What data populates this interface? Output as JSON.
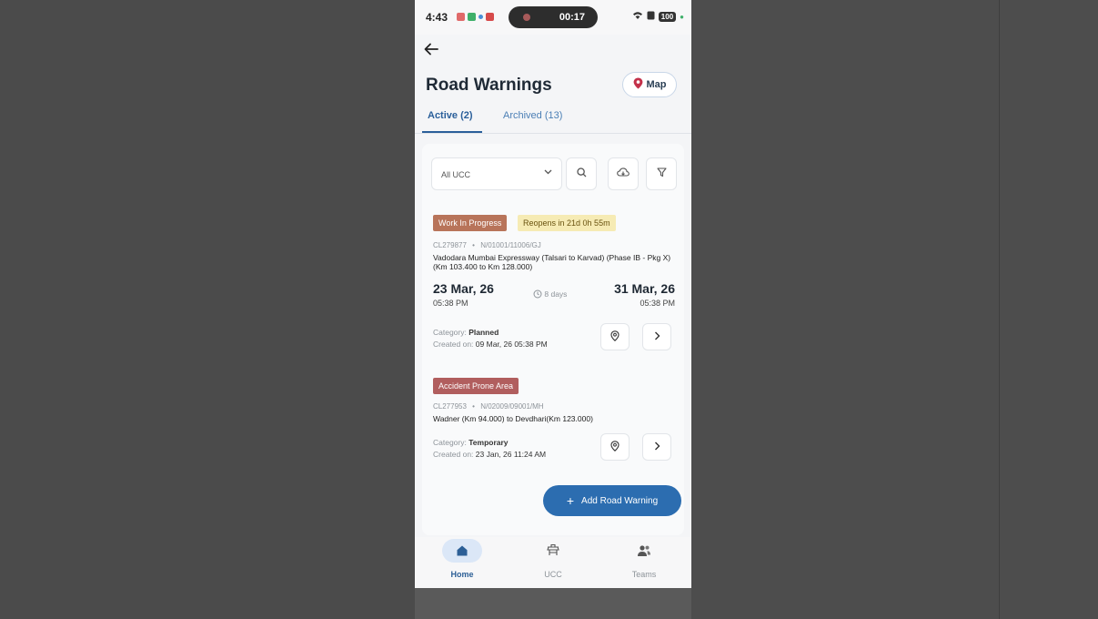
{
  "status_bar": {
    "time": "4:43",
    "timer": "00:17",
    "battery": "100"
  },
  "header": {
    "title": "Road Warnings",
    "map_label": "Map"
  },
  "tabs": [
    {
      "label": "Active (2)",
      "active": true
    },
    {
      "label": "Archived (13)",
      "active": false
    }
  ],
  "filters": {
    "ucc_select": "All UCC"
  },
  "warnings": [
    {
      "status": "Work In Progress",
      "reopen": "Reopens in 21d 0h 55m",
      "id": "CL279877",
      "route": "N/01001/11006/GJ",
      "description": "Vadodara Mumbai Expressway (Talsari to Karvad) (Phase IB - Pkg X) (Km 103.400 to Km 128.000)",
      "start_date": "23 Mar, 26",
      "start_time": "05:38 PM",
      "duration": "8 days",
      "end_date": "31 Mar, 26",
      "end_time": "05:38 PM",
      "category_label": "Category:",
      "category": "Planned",
      "created_label": "Created on:",
      "created": "09 Mar, 26 05:38 PM"
    },
    {
      "status": "Accident Prone Area",
      "id": "CL277953",
      "route": "N/02009/09001/MH",
      "description": "Wadner (Km 94.000) to Devdhari(Km 123.000)",
      "category_label": "Category:",
      "category": "Temporary",
      "created_label": "Created on:",
      "created": "23 Jan, 26 11:24 AM"
    }
  ],
  "fab": {
    "label": "Add Road Warning"
  },
  "bottom_nav": [
    {
      "label": "Home",
      "icon": "home-icon",
      "active": true
    },
    {
      "label": "UCC",
      "icon": "ucc-icon",
      "active": false
    },
    {
      "label": "Teams",
      "icon": "teams-icon",
      "active": false
    }
  ],
  "colors": {
    "primary": "#2c6db0",
    "title": "#1f2a36",
    "wip_badge": "#b8745a",
    "reopen_badge": "#f6ebb4",
    "accident_badge": "#b15e5e",
    "map_pin": "#c3314a"
  }
}
